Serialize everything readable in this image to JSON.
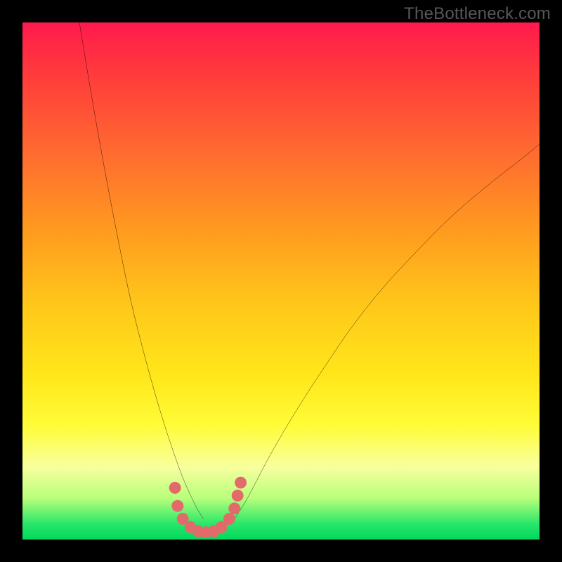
{
  "watermark": "TheBottleneck.com",
  "chart_data": {
    "type": "line",
    "title": "",
    "xlabel": "",
    "ylabel": "",
    "xlim": [
      0,
      100
    ],
    "ylim": [
      0,
      100
    ],
    "series": [
      {
        "name": "bottleneck-left",
        "x": [
          11.0,
          13.5,
          16.0,
          18.5,
          21.0,
          23.5,
          26.0,
          28.5,
          31.0,
          33.5,
          35.0
        ],
        "values": [
          100.0,
          85.0,
          71.0,
          58.0,
          46.0,
          36.0,
          27.0,
          19.0,
          12.0,
          6.5,
          4.0
        ]
      },
      {
        "name": "bottleneck-right",
        "x": [
          41.0,
          43.5,
          48.0,
          53.0,
          58.5,
          64.0,
          70.0,
          76.5,
          83.0,
          90.0,
          97.0,
          100.0
        ],
        "values": [
          4.0,
          8.0,
          16.5,
          25.0,
          33.5,
          41.5,
          49.0,
          56.0,
          62.5,
          68.5,
          74.0,
          76.5
        ]
      }
    ],
    "markers": {
      "name": "optimal-dots",
      "color": "#e26a6a",
      "x": [
        29.5,
        30.0,
        31.0,
        32.5,
        34.0,
        35.5,
        37.0,
        38.5,
        40.0,
        41.0,
        41.6,
        42.2
      ],
      "values": [
        10.0,
        6.5,
        4.0,
        2.4,
        1.6,
        1.4,
        1.6,
        2.4,
        4.0,
        6.0,
        8.5,
        11.0
      ]
    },
    "background_gradient": {
      "top_color": "#ff1a4d",
      "bottom_color": "#00d85c"
    }
  }
}
